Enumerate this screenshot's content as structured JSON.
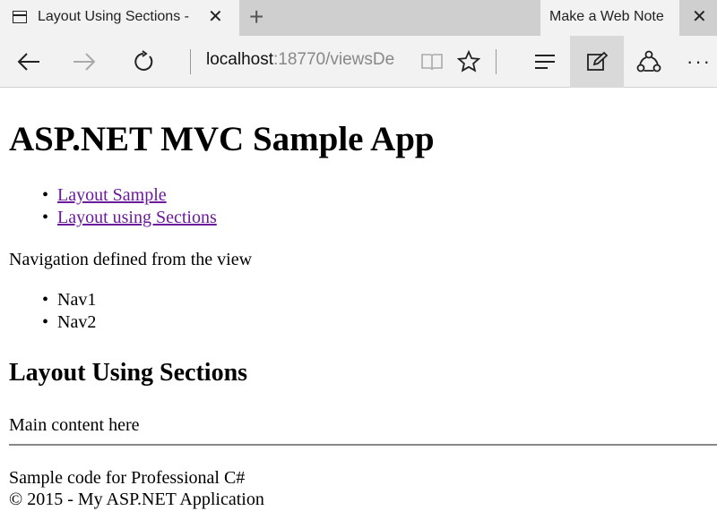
{
  "browser": {
    "tab_title": "Layout Using Sections -",
    "tab_close": "✕",
    "new_tab": "+",
    "webnote_label": "Make a Web Note",
    "window_close": "✕",
    "url_host": "localhost",
    "url_rest": ":18770/viewsDe",
    "more_label": "···"
  },
  "page": {
    "app_title": "ASP.NET MVC Sample App",
    "links": [
      {
        "label": "Layout Sample"
      },
      {
        "label": "Layout using Sections"
      }
    ],
    "nav_description": "Navigation defined from the view",
    "nav_items": [
      {
        "label": "Nav1"
      },
      {
        "label": "Nav2"
      }
    ],
    "section_title": "Layout Using Sections",
    "main_content": "Main content here",
    "footer_line1": "Sample code for Professional C#",
    "footer_line2": "© 2015 - My ASP.NET Application"
  },
  "colors": {
    "link": "#6a1b9a",
    "chrome": "#f2f2f2",
    "tabstrip": "#cfcfcf"
  }
}
